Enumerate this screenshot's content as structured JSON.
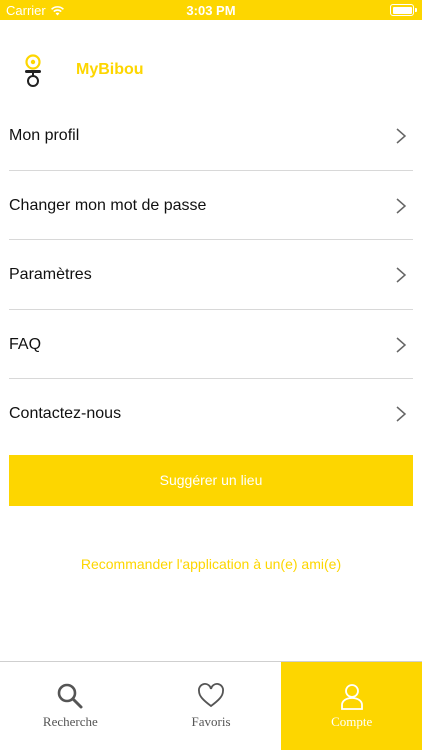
{
  "status_bar": {
    "carrier": "Carrier",
    "time": "3:03 PM"
  },
  "header": {
    "title": "MyBibou",
    "logo_icon": "pacifier-icon"
  },
  "menu": {
    "items": [
      {
        "label": "Mon profil"
      },
      {
        "label": "Changer mon mot de passe"
      },
      {
        "label": "Paramètres"
      },
      {
        "label": "FAQ"
      },
      {
        "label": "Contactez-nous"
      }
    ]
  },
  "actions": {
    "suggest_label": "Suggérer un lieu",
    "recommend_label": "Recommander l'application à un(e) ami(e)"
  },
  "tab_bar": {
    "tabs": [
      {
        "label": "Recherche",
        "icon": "search-icon",
        "active": false
      },
      {
        "label": "Favoris",
        "icon": "heart-icon",
        "active": false
      },
      {
        "label": "Compte",
        "icon": "user-icon",
        "active": true
      }
    ]
  },
  "colors": {
    "accent": "#FDD600",
    "text": "#111111",
    "divider": "#D8D8D8",
    "muted": "#555555"
  }
}
